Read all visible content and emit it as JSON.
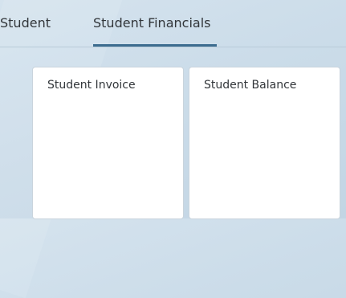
{
  "tabs": [
    {
      "label": "Student",
      "selected": false
    },
    {
      "label": "Student Financials",
      "selected": true
    }
  ],
  "tiles": [
    {
      "title": "Student Invoice"
    },
    {
      "title": "Student Balance"
    }
  ],
  "colors": {
    "accent": "#3c6c8f",
    "background": "#cbdce9",
    "tile_background": "#ffffff",
    "text": "#32363a"
  }
}
